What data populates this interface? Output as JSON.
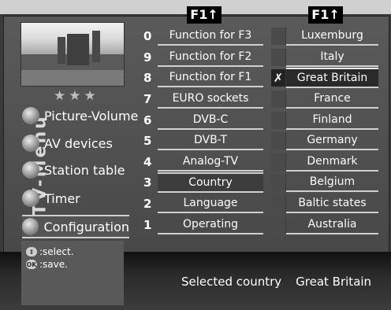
{
  "header": {
    "f1_label": "F1",
    "f1_arrow": "↑"
  },
  "sidebar": {
    "title": "TV-Menu",
    "stars": "★★★",
    "items": [
      {
        "label": "Picture-Volume"
      },
      {
        "label": "AV devices"
      },
      {
        "label": "Station table"
      },
      {
        "label": "Timer"
      },
      {
        "label": "Configuration",
        "active": true
      }
    ]
  },
  "menu": {
    "items": [
      {
        "num": "0",
        "label": "Function for F3"
      },
      {
        "num": "9",
        "label": "Function for F2"
      },
      {
        "num": "8",
        "label": "Function for F1"
      },
      {
        "num": "7",
        "label": "EURO sockets"
      },
      {
        "num": "6",
        "label": "DVB-C"
      },
      {
        "num": "5",
        "label": "DVB-T"
      },
      {
        "num": "4",
        "label": "Analog-TV"
      },
      {
        "num": "3",
        "label": "Country",
        "active": true
      },
      {
        "num": "2",
        "label": "Language"
      },
      {
        "num": "1",
        "label": "Operating"
      }
    ]
  },
  "countries": {
    "items": [
      {
        "label": "Luxemburg"
      },
      {
        "label": "Italy"
      },
      {
        "label": "Great Britain",
        "selected": true,
        "mark": "✗"
      },
      {
        "label": "France"
      },
      {
        "label": "Finland"
      },
      {
        "label": "Germany"
      },
      {
        "label": "Denmark"
      },
      {
        "label": "Belgium"
      },
      {
        "label": "Baltic states"
      },
      {
        "label": "Australia"
      }
    ]
  },
  "hints": {
    "select": ":select.",
    "save": ":save.",
    "ok_label": "OK"
  },
  "status": {
    "label": "Selected country",
    "value": "Great Britain"
  }
}
